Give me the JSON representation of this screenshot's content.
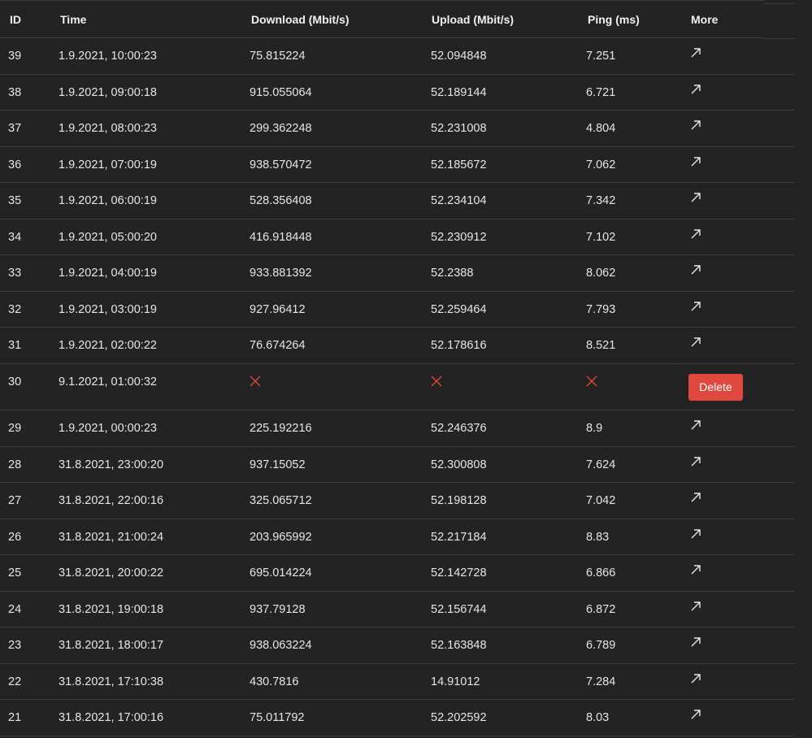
{
  "table": {
    "columns": {
      "id": "ID",
      "time": "Time",
      "download": "Download (Mbit/s)",
      "upload": "Upload (Mbit/s)",
      "ping": "Ping (ms)",
      "more": "More"
    },
    "rows": [
      {
        "id": "39",
        "time": "1.9.2021, 10:00:23",
        "download": "75.815224",
        "upload": "52.094848",
        "ping": "7.251",
        "more_icon": "arrow-up-right-icon"
      },
      {
        "id": "38",
        "time": "1.9.2021, 09:00:18",
        "download": "915.055064",
        "upload": "52.189144",
        "ping": "6.721",
        "more_icon": "arrow-up-right-icon"
      },
      {
        "id": "37",
        "time": "1.9.2021, 08:00:23",
        "download": "299.362248",
        "upload": "52.231008",
        "ping": "4.804",
        "more_icon": "arrow-up-right-icon"
      },
      {
        "id": "36",
        "time": "1.9.2021, 07:00:19",
        "download": "938.570472",
        "upload": "52.185672",
        "ping": "7.062",
        "more_icon": "arrow-up-right-icon"
      },
      {
        "id": "35",
        "time": "1.9.2021, 06:00:19",
        "download": "528.356408",
        "upload": "52.234104",
        "ping": "7.342",
        "more_icon": "arrow-up-right-icon"
      },
      {
        "id": "34",
        "time": "1.9.2021, 05:00:20",
        "download": "416.918448",
        "upload": "52.230912",
        "ping": "7.102",
        "more_icon": "arrow-up-right-icon"
      },
      {
        "id": "33",
        "time": "1.9.2021, 04:00:19",
        "download": "933.881392",
        "upload": "52.2388",
        "ping": "8.062",
        "more_icon": "arrow-up-right-icon"
      },
      {
        "id": "32",
        "time": "1.9.2021, 03:00:19",
        "download": "927.96412",
        "upload": "52.259464",
        "ping": "7.793",
        "more_icon": "arrow-up-right-icon"
      },
      {
        "id": "31",
        "time": "1.9.2021, 02:00:22",
        "download": "76.674264",
        "upload": "52.178616",
        "ping": "8.521",
        "more_icon": "arrow-up-right-icon"
      },
      {
        "id": "30",
        "time": "9.1.2021, 01:00:32",
        "failed": true,
        "delete_label": "Delete",
        "fail_icon": "x-icon",
        "fail_color": "#e0483e",
        "button_color": "#e0483e"
      },
      {
        "id": "29",
        "time": "1.9.2021, 00:00:23",
        "download": "225.192216",
        "upload": "52.246376",
        "ping": "8.9",
        "more_icon": "arrow-up-right-icon"
      },
      {
        "id": "28",
        "time": "31.8.2021, 23:00:20",
        "download": "937.15052",
        "upload": "52.300808",
        "ping": "7.624",
        "more_icon": "arrow-up-right-icon"
      },
      {
        "id": "27",
        "time": "31.8.2021, 22:00:16",
        "download": "325.065712",
        "upload": "52.198128",
        "ping": "7.042",
        "more_icon": "arrow-up-right-icon"
      },
      {
        "id": "26",
        "time": "31.8.2021, 21:00:24",
        "download": "203.965992",
        "upload": "52.217184",
        "ping": "8.83",
        "more_icon": "arrow-up-right-icon"
      },
      {
        "id": "25",
        "time": "31.8.2021, 20:00:22",
        "download": "695.014224",
        "upload": "52.142728",
        "ping": "6.866",
        "more_icon": "arrow-up-right-icon"
      },
      {
        "id": "24",
        "time": "31.8.2021, 19:00:18",
        "download": "937.79128",
        "upload": "52.156744",
        "ping": "6.872",
        "more_icon": "arrow-up-right-icon"
      },
      {
        "id": "23",
        "time": "31.8.2021, 18:00:17",
        "download": "938.063224",
        "upload": "52.163848",
        "ping": "6.789",
        "more_icon": "arrow-up-right-icon"
      },
      {
        "id": "22",
        "time": "31.8.2021, 17:10:38",
        "download": "430.7816",
        "upload": "14.91012",
        "ping": "7.284",
        "more_icon": "arrow-up-right-icon"
      },
      {
        "id": "21",
        "time": "31.8.2021, 17:00:16",
        "download": "75.011792",
        "upload": "52.202592",
        "ping": "8.03",
        "more_icon": "arrow-up-right-icon"
      }
    ]
  },
  "theme": {
    "background": "#232323",
    "text": "#e6e6e6",
    "divider": "#3c3c3c",
    "danger": "#e0483e"
  }
}
